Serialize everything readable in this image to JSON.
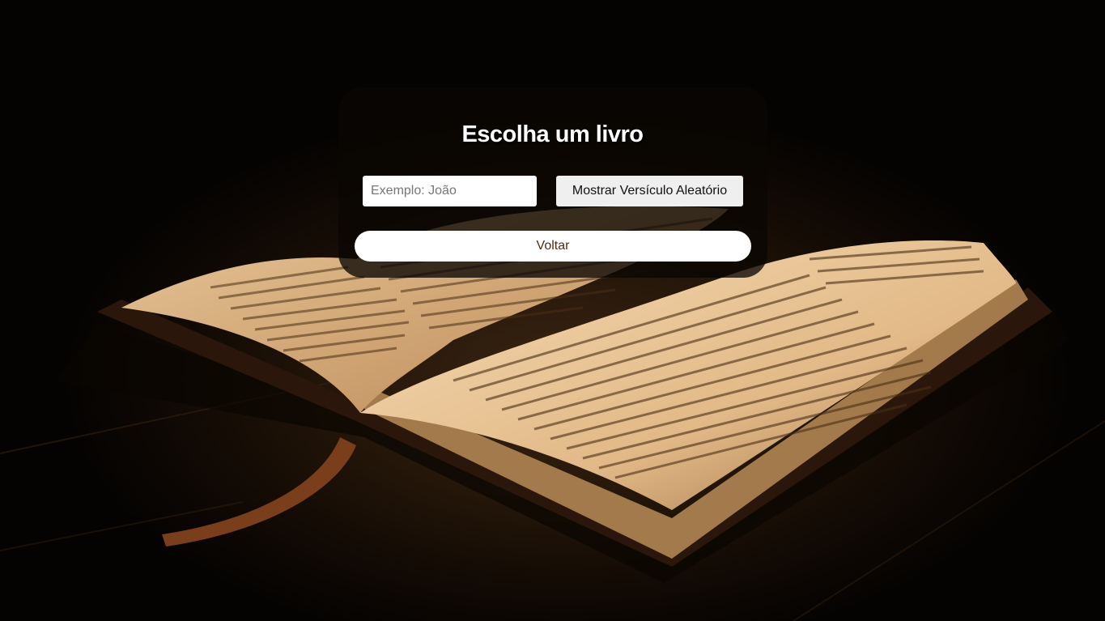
{
  "page": {
    "title": "Escolha um livro"
  },
  "search": {
    "placeholder": "Exemplo: João",
    "value": ""
  },
  "actions": {
    "random_verse_label": "Mostrar Versículo Aleatório",
    "back_label": "Voltar"
  },
  "colors": {
    "panel_bg": "#0a0603",
    "title": "#ffffff",
    "back_text": "#4a2f12",
    "button_bg": "#efefef"
  }
}
